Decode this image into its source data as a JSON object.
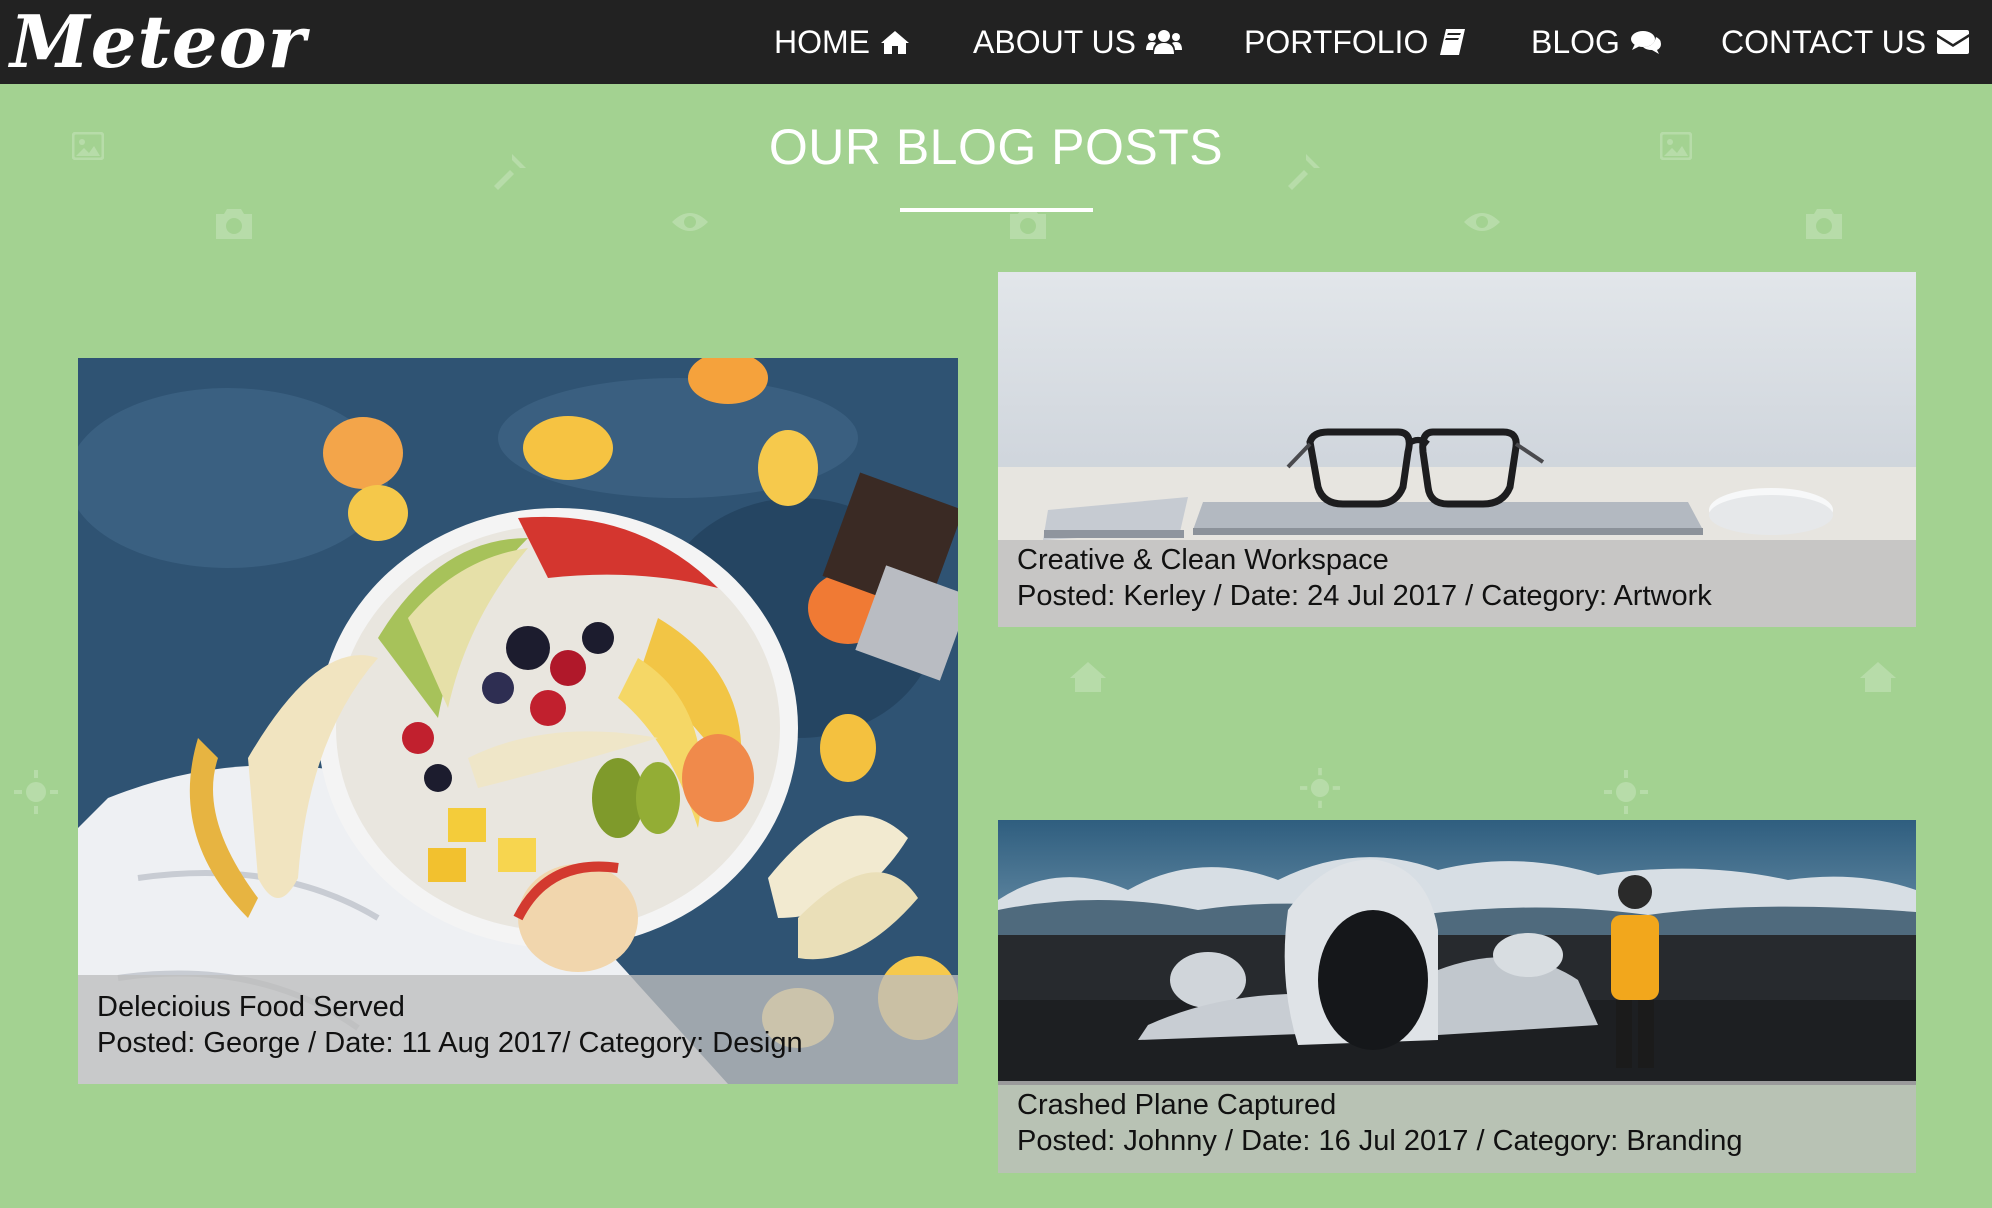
{
  "brand": {
    "logo": "Meteor"
  },
  "nav": [
    {
      "label": "HOME",
      "icon": "home-icon"
    },
    {
      "label": "ABOUT US",
      "icon": "users-icon"
    },
    {
      "label": "PORTFOLIO",
      "icon": "book-icon"
    },
    {
      "label": "BLOG",
      "icon": "comments-icon"
    },
    {
      "label": "CONTACT US",
      "icon": "envelope-icon"
    }
  ],
  "section": {
    "title": "OUR BLOG POSTS"
  },
  "posts": [
    {
      "title": "Delecioius Food Served",
      "meta": "Posted: George / Date: 11 Aug 2017/ Category: Design",
      "image": "fruit-platter-photo"
    },
    {
      "title": "Creative & Clean Workspace",
      "meta": "Posted: Kerley / Date: 24 Jul 2017 / Category: Artwork",
      "image": "glasses-laptop-workspace-photo"
    },
    {
      "title": "Crashed Plane Captured",
      "meta": "Posted: Johnny / Date: 16 Jul 2017 / Category: Branding",
      "image": "crashed-plane-landscape-photo"
    }
  ],
  "colors": {
    "navbar": "#222222",
    "background": "#a3d291",
    "caption_bg": "#bebebe",
    "text_light": "#ffffff"
  }
}
